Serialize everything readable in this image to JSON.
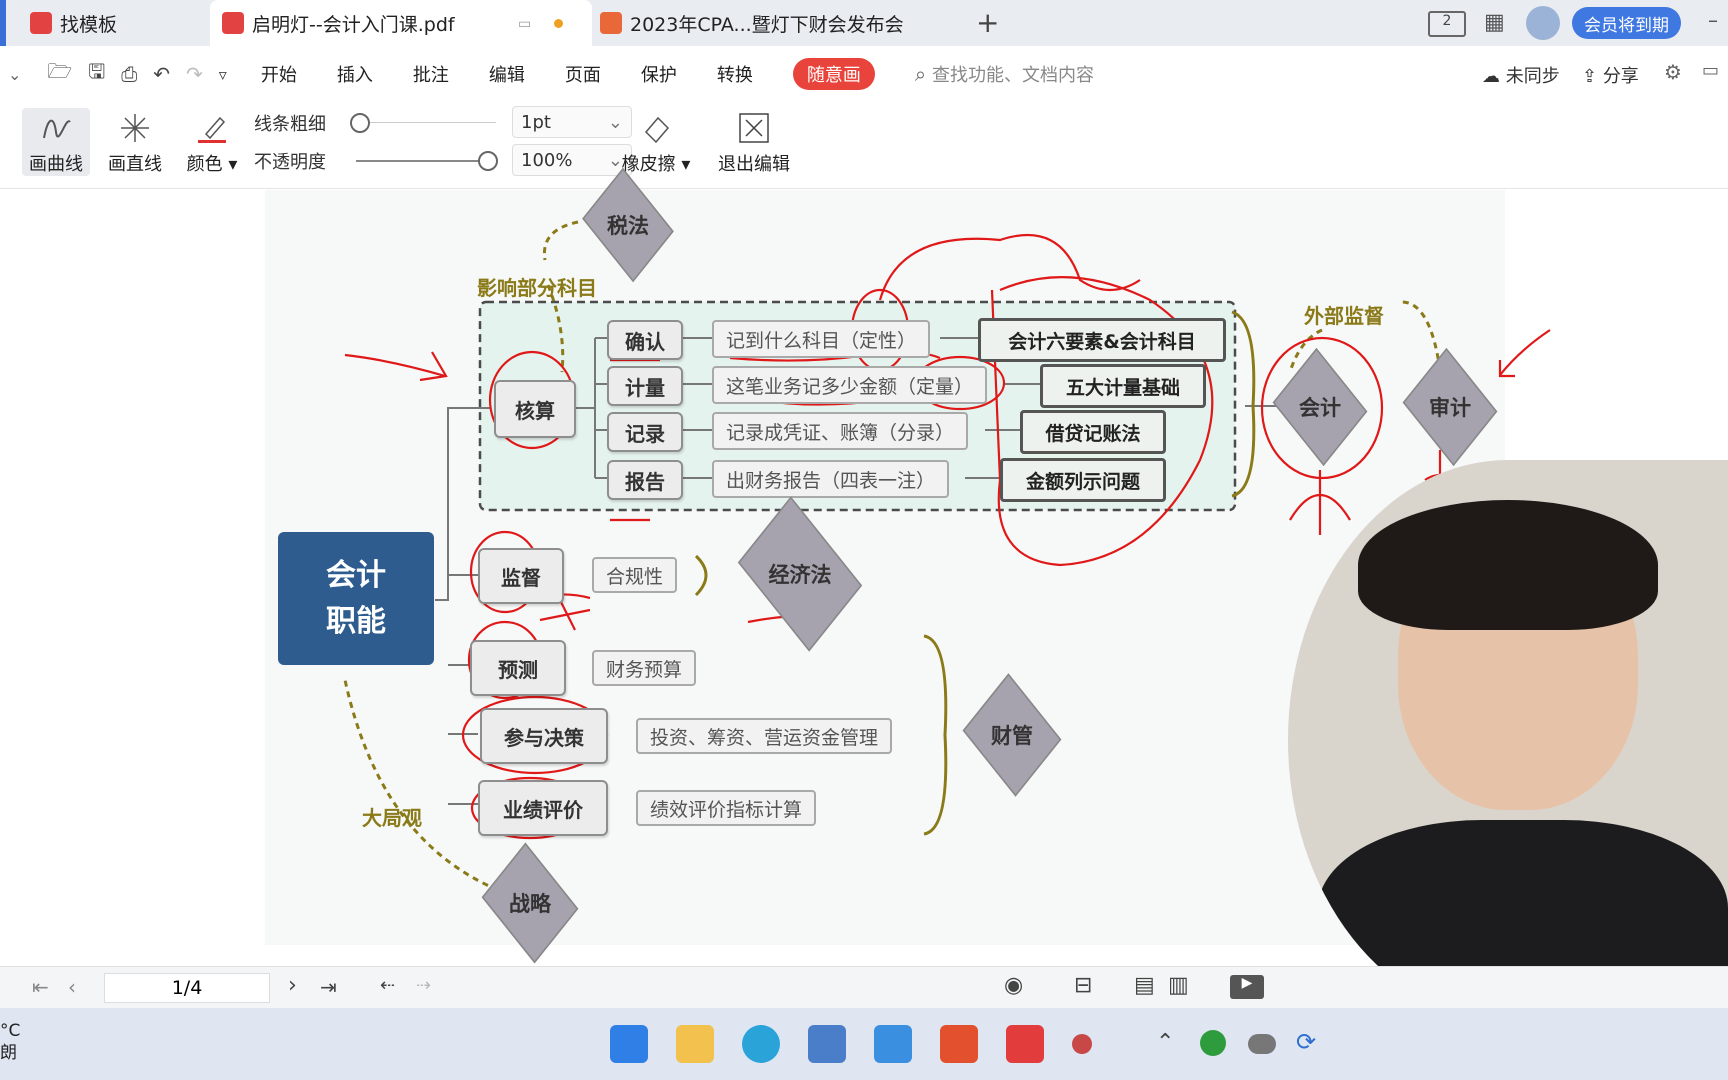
{
  "tabs": [
    {
      "label": "找模板"
    },
    {
      "label": "启明灯--会计入门课.pdf"
    },
    {
      "label": "2023年CPA...暨灯下财会发布会"
    }
  ],
  "top_right": {
    "page_badge": "2",
    "member_button": "会员将到期"
  },
  "menu": {
    "items": [
      "开始",
      "插入",
      "批注",
      "编辑",
      "页面",
      "保护",
      "转换"
    ],
    "special": "随意画",
    "search_placeholder": "查找功能、文档内容",
    "sync": "未同步",
    "share": "分享"
  },
  "toolbar": {
    "curve": "画曲线",
    "line": "画直线",
    "color": "颜色",
    "line_width_label": "线条粗细",
    "line_width_value": "1pt",
    "opacity_label": "不透明度",
    "opacity_value": "100%",
    "eraser": "橡皮擦",
    "exit": "退出编辑"
  },
  "mindmap": {
    "root": "会计\n职能",
    "tax_law": "税法",
    "tax_note": "影响部分科目",
    "accounting_node": "核算",
    "sub": [
      "确认",
      "计量",
      "记录",
      "报告"
    ],
    "descs": [
      "记到什么科目（定性）",
      "这笔业务记多少金额（定量）",
      "记录成凭证、账簿（分录）",
      "出财务报告（四表一注）"
    ],
    "bold": [
      "会计六要素&会计科目",
      "五大计量基础",
      "借贷记账法",
      "金额列示问题"
    ],
    "external_note": "外部监督",
    "accounting_diamond": "会计",
    "audit_diamond": "审计",
    "supervise": "监督",
    "compliance": "合规性",
    "econ_law": "经济法",
    "forecast": "预测",
    "budget": "财务预算",
    "decision": "参与决策",
    "decision_desc": "投资、筹资、营运资金管理",
    "finance": "财管",
    "perf": "业绩评价",
    "perf_desc": "绩效评价指标计算",
    "big_picture": "大局观",
    "strategy": "战略"
  },
  "status": {
    "page": "1/4"
  },
  "taskbar": {
    "weather_line1": "°C",
    "weather_line2": "朗"
  }
}
